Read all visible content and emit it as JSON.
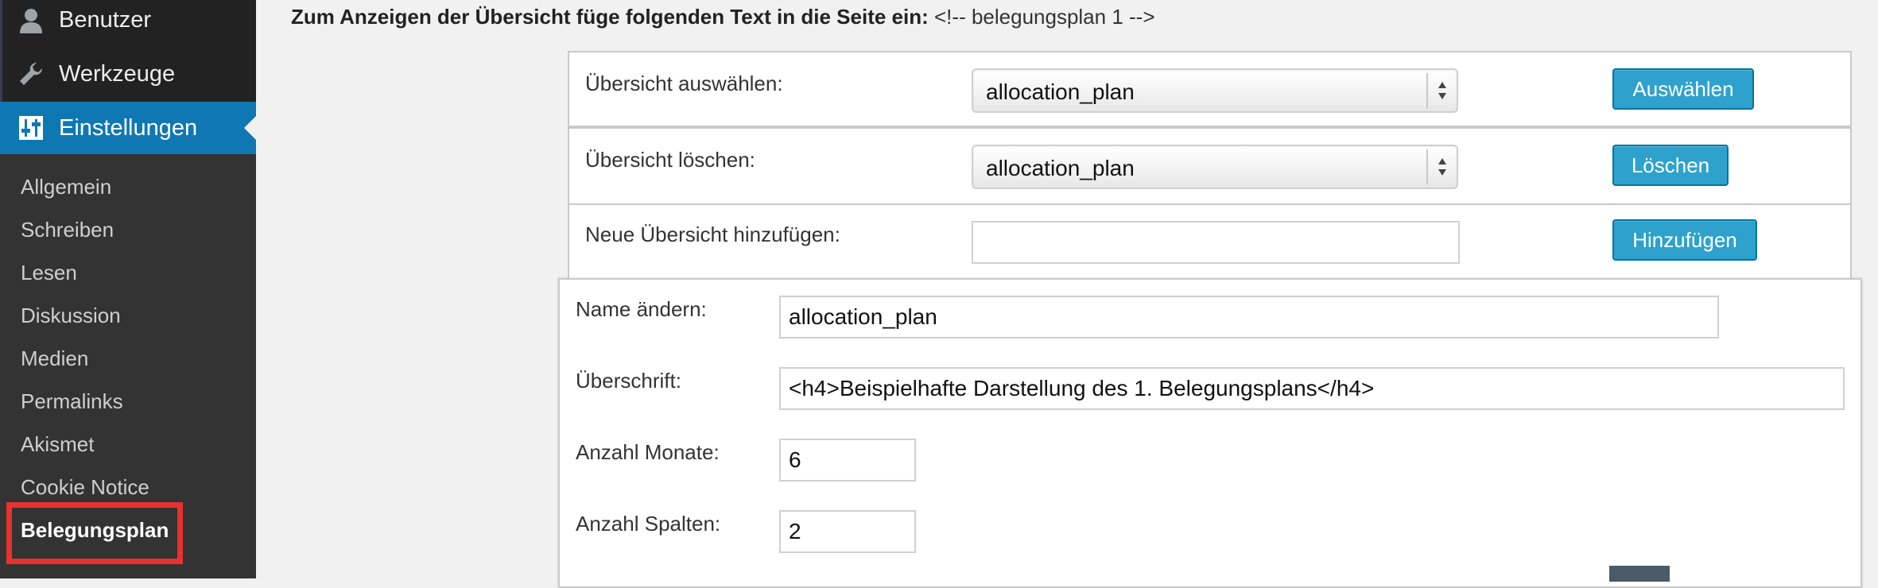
{
  "sidebar": {
    "top_items": [
      {
        "label": "Benutzer",
        "icon": "user-icon"
      },
      {
        "label": "Werkzeuge",
        "icon": "wrench-icon"
      },
      {
        "label": "Einstellungen",
        "icon": "settings-sliders-icon"
      }
    ],
    "submenu": [
      "Allgemein",
      "Schreiben",
      "Lesen",
      "Diskussion",
      "Medien",
      "Permalinks",
      "Akismet",
      "Cookie Notice",
      "Belegungsplan"
    ],
    "current": "Belegungsplan"
  },
  "notice": {
    "prefix": "Zum Anzeigen der Übersicht füge folgenden Text in die Seite ein:",
    "code": "<!-- belegungsplan 1 -->"
  },
  "select_row": {
    "label": "Übersicht auswählen:",
    "value": "allocation_plan",
    "button": "Auswählen"
  },
  "delete_row": {
    "label": "Übersicht löschen:",
    "value": "allocation_plan",
    "button": "Löschen"
  },
  "add_row": {
    "label": "Neue Übersicht hinzufügen:",
    "value": "",
    "button": "Hinzufügen"
  },
  "edit": {
    "name_label": "Name ändern:",
    "name_value": "allocation_plan",
    "heading_label": "Überschrift:",
    "heading_value": "<h4>Beispielhafte Darstellung des 1. Belegungsplans</h4>",
    "months_label": "Anzahl Monate:",
    "months_value": "6",
    "columns_label": "Anzahl Spalten:",
    "columns_value": "2"
  },
  "colors": {
    "accent": "#0f78b3",
    "button": "#2ea2cc",
    "highlight": "#e8322f"
  }
}
